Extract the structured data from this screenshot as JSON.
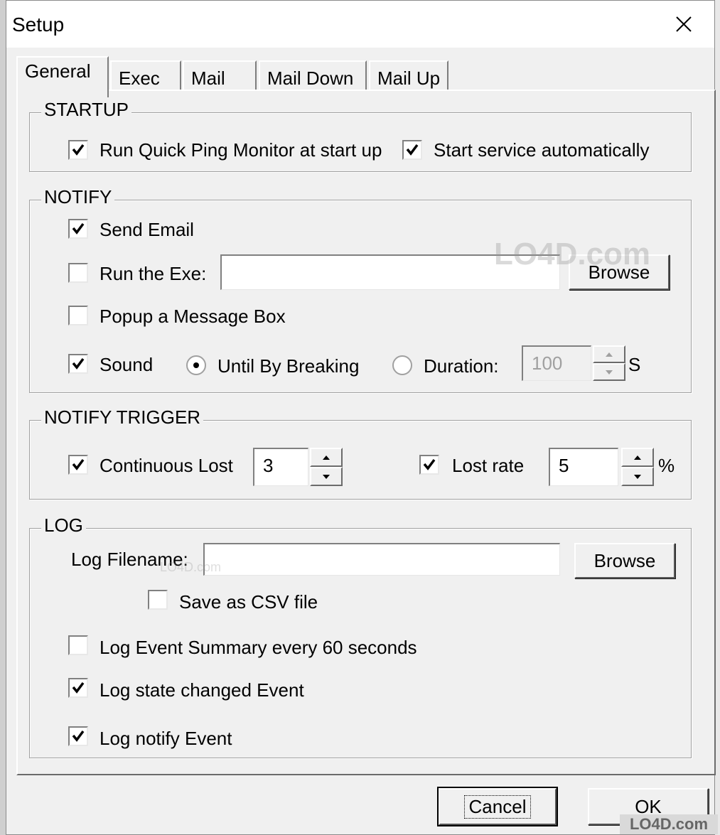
{
  "window": {
    "title": "Setup",
    "close_label": "close"
  },
  "tabs": [
    {
      "label": "General",
      "active": true
    },
    {
      "label": "Exec",
      "active": false
    },
    {
      "label": "Mail",
      "active": false
    },
    {
      "label": "Mail Down",
      "active": false
    },
    {
      "label": "Mail Up",
      "active": false
    }
  ],
  "startup": {
    "title": "STARTUP",
    "run_at_startup": {
      "label": "Run Quick Ping Monitor at start up",
      "checked": true
    },
    "start_service": {
      "label": "Start service automatically",
      "checked": true
    }
  },
  "notify": {
    "title": "NOTIFY",
    "send_email": {
      "label": "Send Email",
      "checked": true
    },
    "run_exe": {
      "label": "Run the Exe:",
      "checked": false,
      "value": ""
    },
    "browse_label": "Browse",
    "popup": {
      "label": "Popup a Message Box",
      "checked": false
    },
    "sound": {
      "label": "Sound",
      "checked": true
    },
    "until_breaking": {
      "label": "Until By Breaking",
      "selected": true
    },
    "duration": {
      "label": "Duration:",
      "selected": false,
      "value": "100",
      "unit": "S"
    }
  },
  "trigger": {
    "title": "NOTIFY TRIGGER",
    "continuous_lost": {
      "label": "Continuous Lost",
      "checked": true,
      "value": "3"
    },
    "lost_rate": {
      "label": "Lost rate",
      "checked": true,
      "value": "5",
      "unit": "%"
    }
  },
  "log": {
    "title": "LOG",
    "filename_label": "Log Filename:",
    "filename_value": "",
    "browse_label": "Browse",
    "save_csv": {
      "label": "Save as CSV file",
      "checked": false
    },
    "event_summary": {
      "label": "Log Event Summary every 60 seconds",
      "checked": false
    },
    "state_changed": {
      "label": "Log state changed Event",
      "checked": true
    },
    "notify_event": {
      "label": "Log notify Event",
      "checked": true
    }
  },
  "footer": {
    "cancel_label": "Cancel",
    "ok_label": "OK"
  },
  "watermark": {
    "text": "LO4D.com",
    "badge": "LO4D.com"
  }
}
